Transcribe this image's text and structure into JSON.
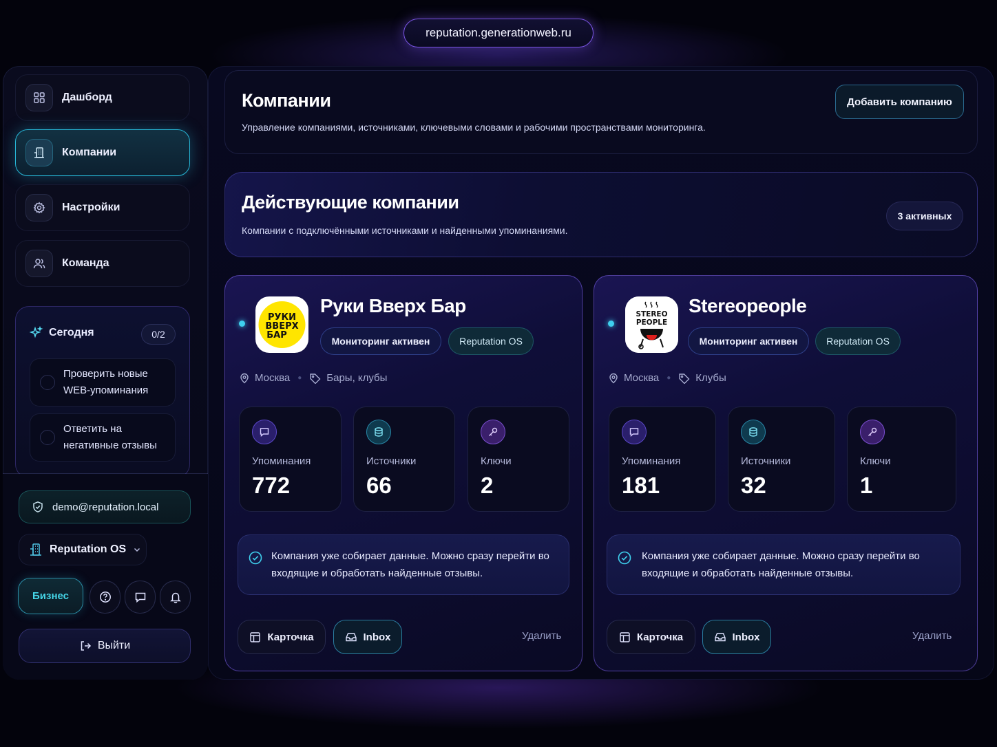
{
  "browser": {
    "url": "reputation.generationweb.ru"
  },
  "sidebar": {
    "nav": [
      {
        "label": "Дашборд",
        "icon": "grid-icon"
      },
      {
        "label": "Компании",
        "icon": "building-icon",
        "active": true
      },
      {
        "label": "Настройки",
        "icon": "gear-icon"
      },
      {
        "label": "Команда",
        "icon": "users-icon"
      }
    ],
    "today": {
      "title": "Сегодня",
      "count": "0/2",
      "tasks": [
        {
          "label": "Проверить новые WEB-упоминания"
        },
        {
          "label": "Ответить на негативные отзывы"
        }
      ]
    },
    "account": {
      "email": "demo@reputation.local",
      "workspace": "Reputation OS",
      "plan": "Бизнес",
      "logout": "Выйти"
    }
  },
  "header": {
    "title": "Компании",
    "subtitle": "Управление компаниями, источниками, ключевыми словами и рабочими пространствами мониторинга.",
    "add_button": "Добавить компанию"
  },
  "active_section": {
    "title": "Действующие компании",
    "subtitle": "Компании с подключёнными источниками и найденными упоминаниями.",
    "badge": "3 активных"
  },
  "companies": [
    {
      "name": "Руки Вверх Бар",
      "logo_text": [
        "РУКИ",
        "ВВЕРХ",
        "БАР"
      ],
      "chips": [
        "Мониторинг активен",
        "Reputation OS"
      ],
      "city": "Москва",
      "category": "Бары, клубы",
      "stats": [
        {
          "label": "Упоминания",
          "value": "772"
        },
        {
          "label": "Источники",
          "value": "66"
        },
        {
          "label": "Ключи",
          "value": "2"
        }
      ],
      "notice": "Компания уже собирает данные. Можно сразу перейти во входящие и обработать найденные отзывы.",
      "actions": {
        "card": "Карточка",
        "inbox": "Inbox",
        "delete": "Удалить"
      }
    },
    {
      "name": "Stereopeople",
      "logo_text": [
        "STEREO",
        "PEOPLE"
      ],
      "chips": [
        "Мониторинг активен",
        "Reputation OS"
      ],
      "city": "Москва",
      "category": "Клубы",
      "stats": [
        {
          "label": "Упоминания",
          "value": "181"
        },
        {
          "label": "Источники",
          "value": "32"
        },
        {
          "label": "Ключи",
          "value": "1"
        }
      ],
      "notice": "Компания уже собирает данные. Можно сразу перейти во входящие и обработать найденные отзывы.",
      "actions": {
        "card": "Карточка",
        "inbox": "Inbox",
        "delete": "Удалить"
      }
    }
  ],
  "colors": {
    "accent_cyan": "#3fd0ee",
    "accent_purple": "#7b55e6",
    "background": "#03030c",
    "logo_yellow": "#ffe500"
  }
}
